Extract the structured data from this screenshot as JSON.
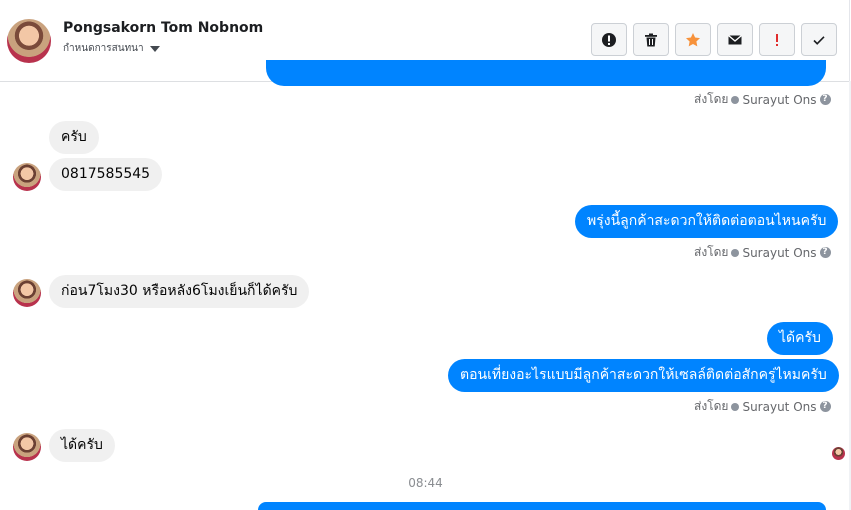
{
  "header": {
    "contact_name": "Pongsakorn Tom Nobnom",
    "assign_label": "กำหนดการสนทนา",
    "actions": [
      {
        "name": "spam",
        "icon": "exclamation-circle-icon"
      },
      {
        "name": "delete",
        "icon": "trash-icon"
      },
      {
        "name": "star",
        "icon": "star-icon",
        "color": "#f7923b"
      },
      {
        "name": "mark-unread",
        "icon": "envelope-icon"
      },
      {
        "name": "follow-up",
        "icon": "exclamation-icon",
        "color": "#e02d2d"
      },
      {
        "name": "done",
        "icon": "check-icon"
      }
    ]
  },
  "messages": [
    {
      "dir": "out",
      "text": "",
      "sent_by_label": "ส่งโดย",
      "sender": "Surayut Ons"
    },
    {
      "dir": "in",
      "text": "ครับ"
    },
    {
      "dir": "in",
      "text": "0817585545"
    },
    {
      "dir": "out",
      "text": "พรุ่งนี้ลูกค้าสะดวกให้ติดต่อตอนไหนครับ",
      "sent_by_label": "ส่งโดย",
      "sender": "Surayut Ons"
    },
    {
      "dir": "in",
      "text": "ก่อน7โมง30 หรือหลัง6โมงเย็นก็ได้ครับ"
    },
    {
      "dir": "out",
      "text": "ได้ครับ"
    },
    {
      "dir": "out",
      "text": "ตอนเที่ยงอะไรแบบมีลูกค้าสะดวกให้เซลล์ติดต่อสักครู่ไหมครับ",
      "sent_by_label": "ส่งโดย",
      "sender": "Surayut Ons"
    },
    {
      "dir": "in",
      "text": "ได้ครับ"
    }
  ],
  "timestamp": "08:44",
  "colors": {
    "outgoing": "#0084ff",
    "incoming": "#f0f0f0"
  }
}
